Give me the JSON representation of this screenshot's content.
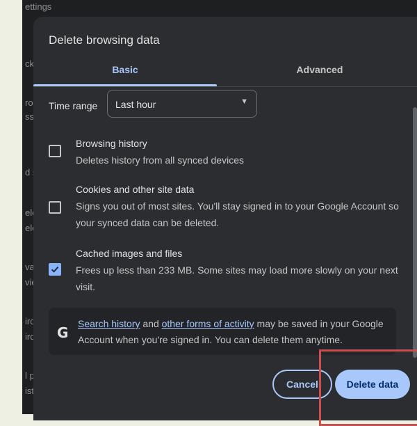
{
  "background": {
    "fragments": [
      "ettings",
      "ck",
      "ror",
      "ssw",
      "d s",
      "elet",
      "elet",
      "va",
      "vie",
      "ird",
      "ird",
      "l p",
      "isto"
    ]
  },
  "dialog": {
    "title": "Delete browsing data",
    "tabs": [
      {
        "label": "Basic",
        "active": true
      },
      {
        "label": "Advanced",
        "active": false
      }
    ],
    "time_range": {
      "label": "Time range",
      "value": "Last hour"
    },
    "options": [
      {
        "title": "Browsing history",
        "description": "Deletes history from all synced devices",
        "checked": false
      },
      {
        "title": "Cookies and other site data",
        "description": "Signs you out of most sites. You'll stay signed in to your Google Account so your synced data can be deleted.",
        "checked": false
      },
      {
        "title": "Cached images and files",
        "description": "Frees up less than 233 MB. Some sites may load more slowly on your next visit.",
        "checked": true
      }
    ],
    "info": {
      "icon": "google-g-icon",
      "glyph": "G",
      "link1": "Search history",
      "text1": " and ",
      "link2": "other forms of activity",
      "text2": " may be saved in your Google Account when you're signed in. You can delete them anytime."
    },
    "buttons": {
      "cancel": "Cancel",
      "delete": "Delete data"
    }
  },
  "colors": {
    "accent": "#a8c7fa",
    "dialog_bg": "#2c2d30",
    "annotation": "#c9504f"
  }
}
